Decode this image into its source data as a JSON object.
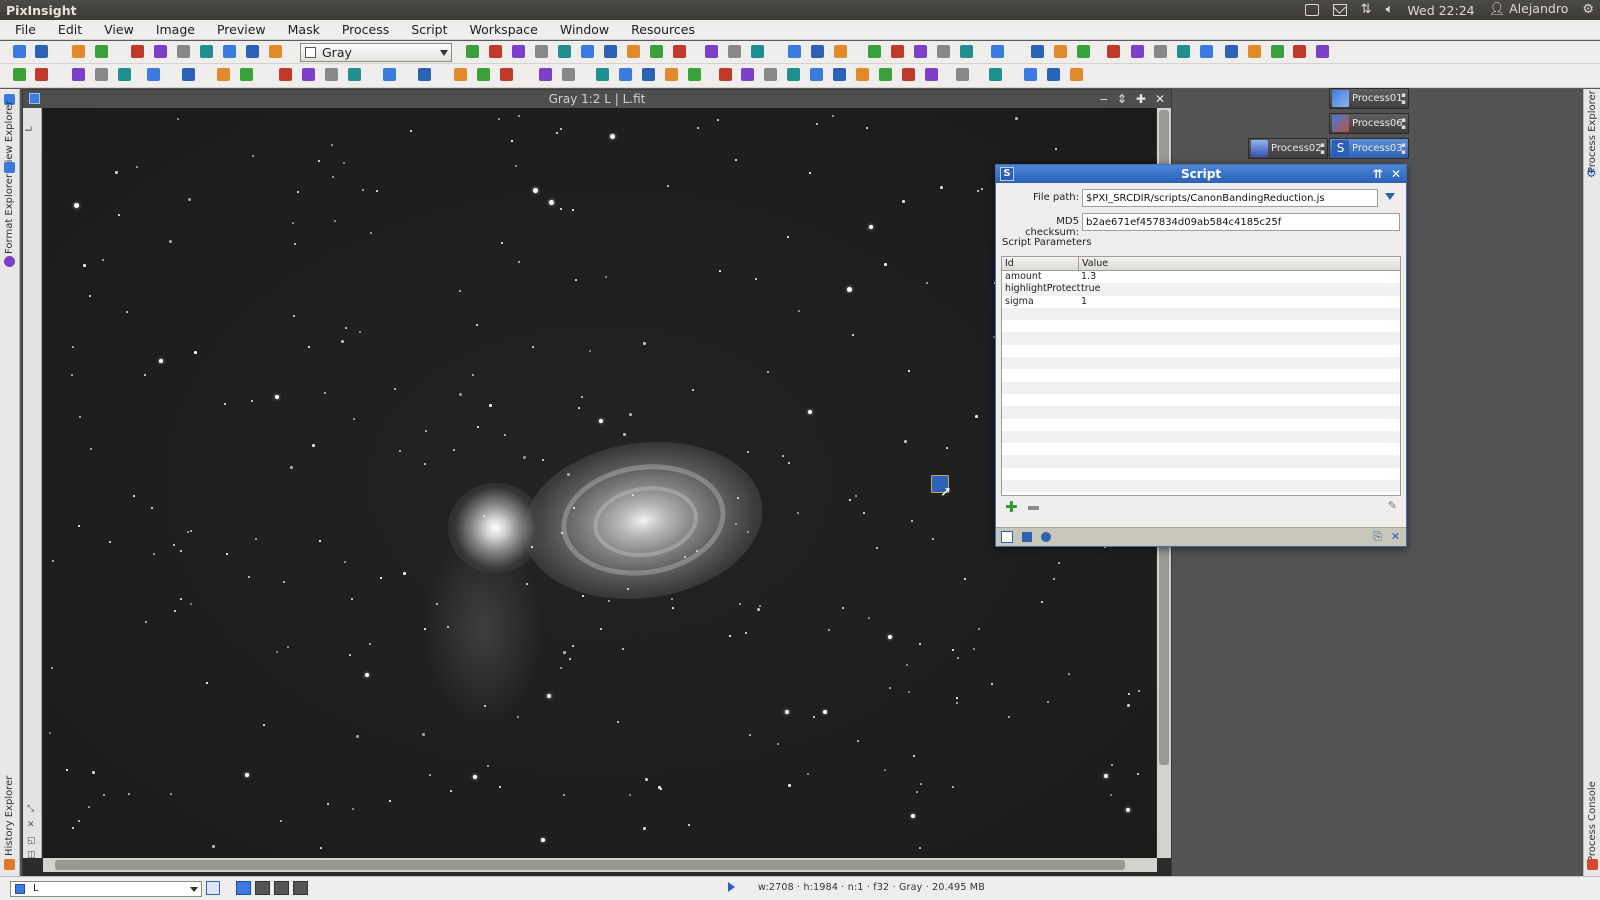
{
  "top_panel": {
    "app_title": "PixInsight",
    "clock": "Wed 22:24",
    "user": "Alejandro"
  },
  "menubar": {
    "items": [
      "File",
      "Edit",
      "View",
      "Image",
      "Preview",
      "Mask",
      "Process",
      "Script",
      "Workspace",
      "Window",
      "Resources"
    ]
  },
  "toolbar": {
    "colorspace_value": "Gray"
  },
  "left_dock": {
    "tabs": [
      "View Explorer",
      "Format Explorer",
      "History Explorer"
    ]
  },
  "right_dock": {
    "tabs": [
      "Process Explorer",
      "Process Console"
    ]
  },
  "image_window": {
    "title": "Gray 1:2 L | L.fit",
    "side_label": "L"
  },
  "process_icons": [
    {
      "label": "Process01",
      "icon": "image-icon",
      "selected": false
    },
    {
      "label": "Process06",
      "icon": "image-icon",
      "selected": false
    },
    {
      "label": "Process02",
      "icon": "histogram-icon",
      "selected": false
    },
    {
      "label": "Process03",
      "icon": "script-icon",
      "selected": true
    }
  ],
  "script_dialog": {
    "title": "Script",
    "file_path_label": "File path:",
    "file_path_value": "$PXI_SRCDIR/scripts/CanonBandingReduction.js",
    "md5_label": "MD5 checksum:",
    "md5_value": "b2ae671ef457834d09ab584c4185c25f",
    "params_section_label": "Script Parameters",
    "columns": [
      "Id",
      "Value"
    ],
    "rows": [
      {
        "id": "amount",
        "value": "1.3"
      },
      {
        "id": "highlightProtect",
        "value": "true"
      },
      {
        "id": "sigma",
        "value": "1"
      }
    ]
  },
  "statusbar": {
    "view_select_value": "L",
    "info": "w:2708 · h:1984 · n:1 · f32 · Gray · 20.495 MB"
  },
  "colors": {
    "accent_blue": "#2c62b5",
    "menu_bg": "#efeeec",
    "workspace_bg": "#535353",
    "panel_bg": "#3c3b37"
  }
}
